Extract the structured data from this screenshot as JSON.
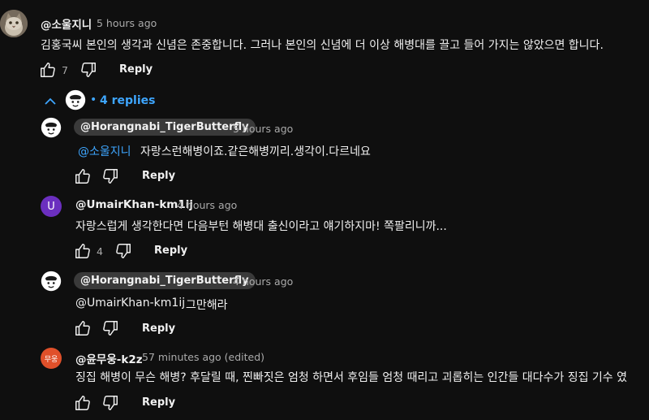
{
  "colors": {
    "background": "#0f0f0f",
    "link": "#3ea6ff",
    "muted": "#aaaaaa",
    "chip": "#3a3a3a",
    "avatar_u": "#6b2fbf",
    "avatar_mu": "#e0502a"
  },
  "top_comment": {
    "author": "@소울지니",
    "time": "5 hours ago",
    "text": "김홍국씨 본인의 생각과 신념은 존중합니다. 그러나 본인의 신념에 더 이상 해병대를 끌고 들어 가지는 않았으면 합니다.",
    "likes": "7",
    "reply_label": "Reply",
    "icons": {
      "like": "thumb-up-icon",
      "dislike": "thumb-down-icon"
    }
  },
  "replies_toggle": {
    "icon": "chevron-up-icon",
    "label": "4 replies"
  },
  "replies": [
    {
      "author": "@Horangnabi_TigerButterfly",
      "time": "5 hours ago",
      "mention": "@소울지니",
      "text": "자랑스런해병이죠.같은해병끼리.생각이.다르네요",
      "likes": "",
      "reply_label": "Reply"
    },
    {
      "author": "@UmairKhan-km1ij",
      "avatar_letter": "U",
      "time": "4 hours ago",
      "text": "자랑스럽게 생각한다면 다음부턴 해병대 출신이라고 얘기하지마! 쪽팔리니까...",
      "likes": "4",
      "reply_label": "Reply"
    },
    {
      "author": "@Horangnabi_TigerButterfly",
      "time": "4 hours ago",
      "mention": "@UmairKhan-km1ij",
      "text": "그만해라",
      "likes": "",
      "reply_label": "Reply"
    },
    {
      "author": "@윤무웅-k2z",
      "avatar_letter": "무웅",
      "time": "57 minutes ago (edited)",
      "text": "징집 해병이 무슨 해병? 후달릴 때, 찐빠짓은 엄청 하면서 후임들 엄청 때리고 괴롭히는 인간들 대다수가 징집 기수 였",
      "likes": "",
      "reply_label": "Reply"
    }
  ]
}
